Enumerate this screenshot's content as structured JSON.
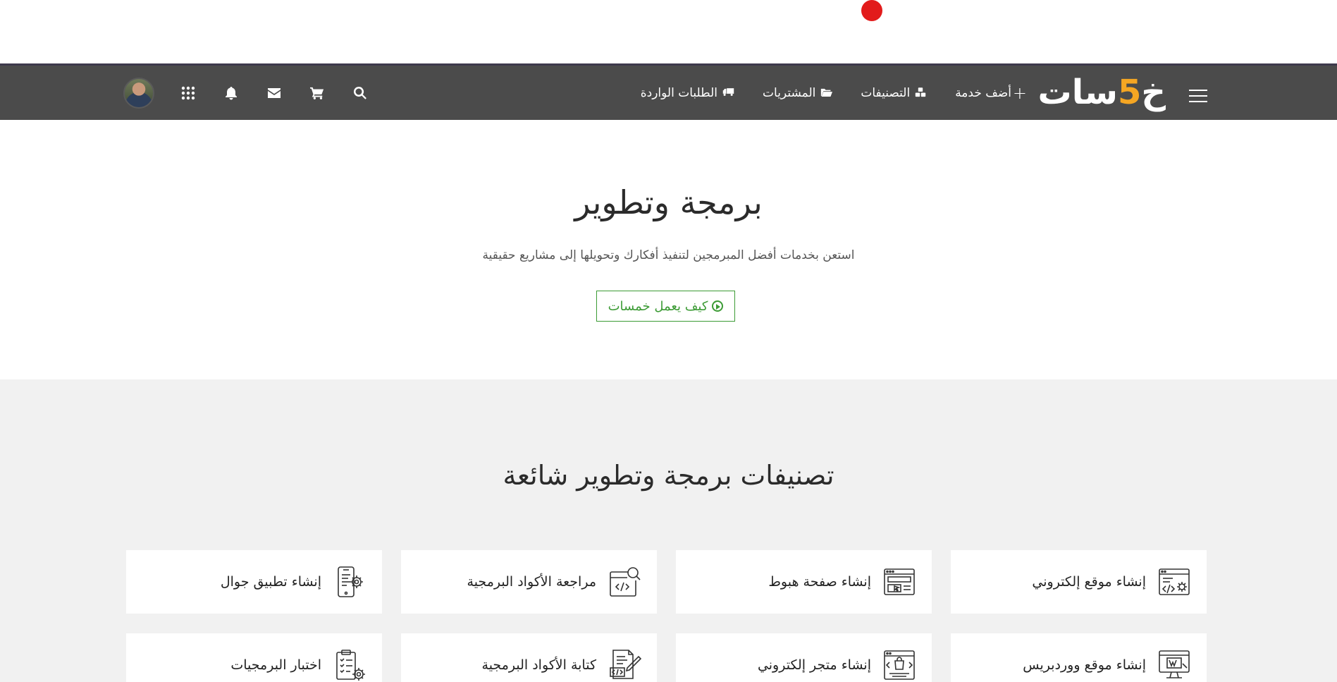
{
  "navbar": {
    "logo": {
      "text_main": "خمسات",
      "text_prefix": "خ",
      "digit": "5",
      "text_suffix": "سات"
    },
    "links": [
      {
        "label": "أضف خدمة",
        "icon": "plus-icon"
      },
      {
        "label": "التصنيفات",
        "icon": "cubes-icon"
      },
      {
        "label": "المشتريات",
        "icon": "folder-open-icon"
      },
      {
        "label": "الطلبات الواردة",
        "icon": "truck-icon"
      }
    ],
    "icons": [
      "search-icon",
      "cart-icon",
      "envelope-icon",
      "bell-icon",
      "apps-grid-icon",
      "avatar"
    ]
  },
  "hero": {
    "title": "برمجة وتطوير",
    "subtitle": "استعن بخدمات أفضل المبرمجين لتنفيذ أفكارك وتحويلها إلى مشاريع حقيقية",
    "button_label": "كيف يعمل خمسات"
  },
  "categories": {
    "title": "تصنيفات برمجة وتطوير شائعة",
    "items": [
      {
        "label": "إنشاء موقع إلكتروني",
        "icon": "website-settings-icon"
      },
      {
        "label": "إنشاء صفحة هبوط",
        "icon": "landing-page-icon"
      },
      {
        "label": "مراجعة الأكواد البرمجية",
        "icon": "code-review-icon"
      },
      {
        "label": "إنشاء تطبيق جوال",
        "icon": "mobile-app-icon"
      },
      {
        "label": "إنشاء موقع ووردبريس",
        "icon": "wordpress-icon"
      },
      {
        "label": "إنشاء متجر إلكتروني",
        "icon": "ecommerce-icon"
      },
      {
        "label": "كتابة الأكواد البرمجية",
        "icon": "code-writing-icon"
      },
      {
        "label": "اختبار البرمجيات",
        "icon": "software-testing-icon"
      }
    ]
  },
  "colors": {
    "navbar_bg": "#4b4b4b",
    "accent_green": "#3c9b35",
    "logo_accent": "#f5a623",
    "section_bg": "#f1f1f1",
    "notification_dot": "#e21b1b"
  }
}
